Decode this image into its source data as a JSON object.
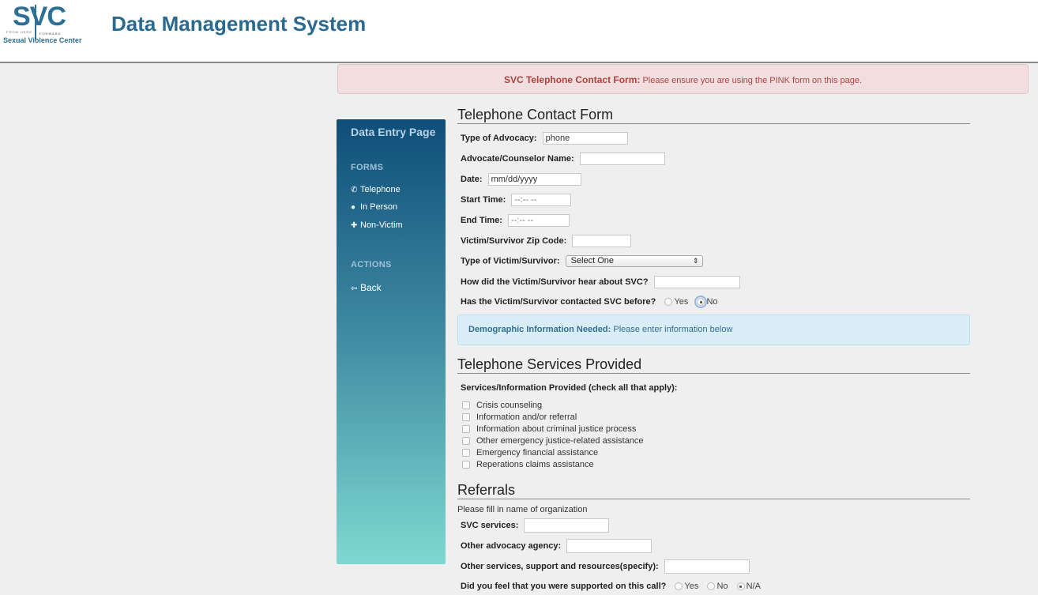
{
  "header": {
    "logo_letters": "SVC",
    "logo_tag_left": "FROM HERE",
    "logo_tag_right": "FORWARD",
    "logo_name": "Sexual Violence Center",
    "app_title": "Data Management System",
    "brand_color": "#2a6a8f"
  },
  "banner": {
    "strong": "SVC Telephone Contact Form:",
    "text": " Please ensure you are using the PINK form on this page."
  },
  "sidebar": {
    "title": "Data Entry Page",
    "forms_heading": "FORMS",
    "forms": [
      {
        "label": "Telephone",
        "icon": "phone-icon",
        "glyph": "✆"
      },
      {
        "label": "In Person",
        "icon": "user-icon",
        "glyph": "👤"
      },
      {
        "label": "Non-Victim",
        "icon": "plus-icon",
        "glyph": "✚"
      }
    ],
    "actions_heading": "ACTIONS",
    "actions": [
      {
        "label": "Back",
        "icon": "arrow-left-icon",
        "glyph": "⇦"
      }
    ]
  },
  "form": {
    "title": "Telephone Contact Form",
    "type_advocacy_label": "Type of Advocacy:",
    "type_advocacy_value": "phone",
    "advocate_label": "Advocate/Counselor Name:",
    "advocate_value": "",
    "date_label": "Date:",
    "date_placeholder": "mm/dd/yyyy",
    "start_label": "Start Time:",
    "start_placeholder": "--:-- --",
    "end_label": "End Time:",
    "end_placeholder": "--:-- --",
    "zip_label": "Victim/Survivor Zip Code:",
    "zip_value": "",
    "type_victim_label": "Type of Victim/Survivor:",
    "type_victim_value": "Select One",
    "hear_label": "How did the Victim/Survivor hear about SVC?",
    "hear_value": "",
    "contacted_label": "Has the Victim/Survivor contacted SVC before?",
    "contacted_options": [
      "Yes",
      "No"
    ],
    "contacted_selected": "No"
  },
  "demographic": {
    "strong": "Demographic Information Needed:",
    "text": " Please enter information below"
  },
  "services": {
    "title": "Telephone Services Provided",
    "subhead": "Services/Information Provided (check all that apply):",
    "items": [
      "Crisis counseling",
      "Information and/or referral",
      "Information about criminal justice process",
      "Other emergency justice-related assistance",
      "Emergency financial assistance",
      "Reperations claims assistance"
    ]
  },
  "referrals": {
    "title": "Referrals",
    "note": "Please fill in name of organization",
    "svc_label": "SVC services:",
    "other_agency_label": "Other advocacy agency:",
    "other_services_label": "Other services, support and resources(specify):",
    "supported_label": "Did you feel that you were supported on this call?",
    "supported_options": [
      "Yes",
      "No",
      "N/A"
    ],
    "supported_selected": "N/A"
  }
}
